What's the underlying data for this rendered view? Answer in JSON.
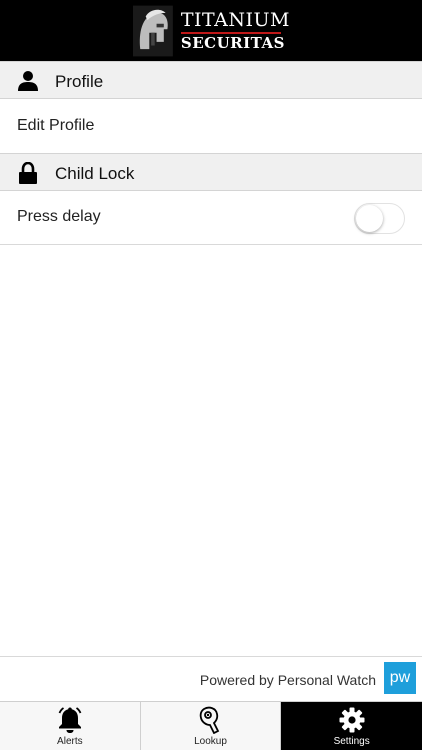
{
  "header": {
    "logo_line1": "TITANIUM",
    "logo_line2": "SECURITAS",
    "accent_color": "#c01818"
  },
  "sections": [
    {
      "title": "Profile",
      "icon": "person-icon",
      "rows": [
        {
          "label": "Edit Profile"
        }
      ]
    },
    {
      "title": "Child Lock",
      "icon": "lock-icon",
      "rows": [
        {
          "label": "Press delay",
          "toggle_on": false
        }
      ]
    }
  ],
  "footer": {
    "powered_by": "Powered by Personal Watch",
    "badge": "pw",
    "badge_color": "#1e9fdb"
  },
  "tabs": [
    {
      "label": "Alerts",
      "icon": "bell-icon",
      "active": false
    },
    {
      "label": "Lookup",
      "icon": "key-tag-icon",
      "active": false
    },
    {
      "label": "Settings",
      "icon": "gear-icon",
      "active": true
    }
  ]
}
